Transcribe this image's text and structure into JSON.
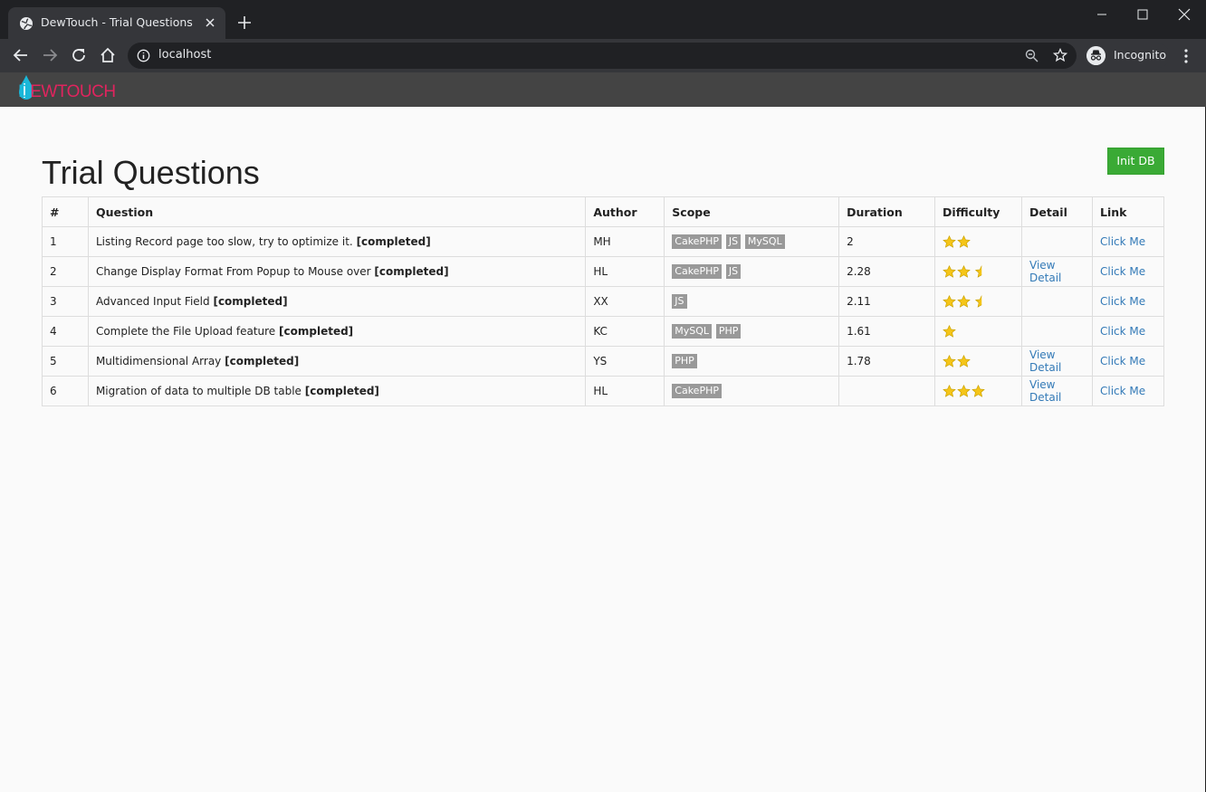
{
  "browser": {
    "tab_title": "DewTouch - Trial Questions",
    "url": "localhost",
    "profile_label": "Incognito"
  },
  "app": {
    "logo_text_first": "D",
    "logo_text_rest": "EWTOUCH",
    "accent_colors": {
      "logo_blue": "#1ab7d8",
      "logo_pink": "#e0245e",
      "button_green": "#3aaa35",
      "link_blue": "#337ab7",
      "tag_grey": "#999999"
    }
  },
  "page": {
    "title": "Trial Questions",
    "init_button": "Init DB"
  },
  "table": {
    "headers": [
      "#",
      "Question",
      "Author",
      "Scope",
      "Duration",
      "Difficulty",
      "Detail",
      "Link"
    ],
    "rows": [
      {
        "num": "1",
        "question": "Listing Record page too slow, try to optimize it.",
        "status": "[completed]",
        "author": "MH",
        "scope": [
          "CakePHP",
          "JS",
          "MySQL"
        ],
        "duration": "2",
        "difficulty": 2,
        "detail": "",
        "link": "Click Me"
      },
      {
        "num": "2",
        "question": "Change Display Format From Popup to Mouse over",
        "status": "[completed]",
        "author": "HL",
        "scope": [
          "CakePHP",
          "JS"
        ],
        "duration": "2.28",
        "difficulty": 2.5,
        "detail": "View Detail",
        "link": "Click Me"
      },
      {
        "num": "3",
        "question": "Advanced Input Field",
        "status": "[completed]",
        "author": "XX",
        "scope": [
          "JS"
        ],
        "duration": "2.11",
        "difficulty": 2.5,
        "detail": "",
        "link": "Click Me"
      },
      {
        "num": "4",
        "question": "Complete the File Upload feature",
        "status": "[completed]",
        "author": "KC",
        "scope": [
          "MySQL",
          "PHP"
        ],
        "duration": "1.61",
        "difficulty": 1,
        "detail": "",
        "link": "Click Me"
      },
      {
        "num": "5",
        "question": "Multidimensional Array",
        "status": "[completed]",
        "author": "YS",
        "scope": [
          "PHP"
        ],
        "duration": "1.78",
        "difficulty": 2,
        "detail": "View Detail",
        "link": "Click Me"
      },
      {
        "num": "6",
        "question": "Migration of data to multiple DB table",
        "status": "[completed]",
        "author": "HL",
        "scope": [
          "CakePHP"
        ],
        "duration": "",
        "difficulty": 3,
        "detail": "View Detail",
        "link": "Click Me"
      }
    ]
  }
}
